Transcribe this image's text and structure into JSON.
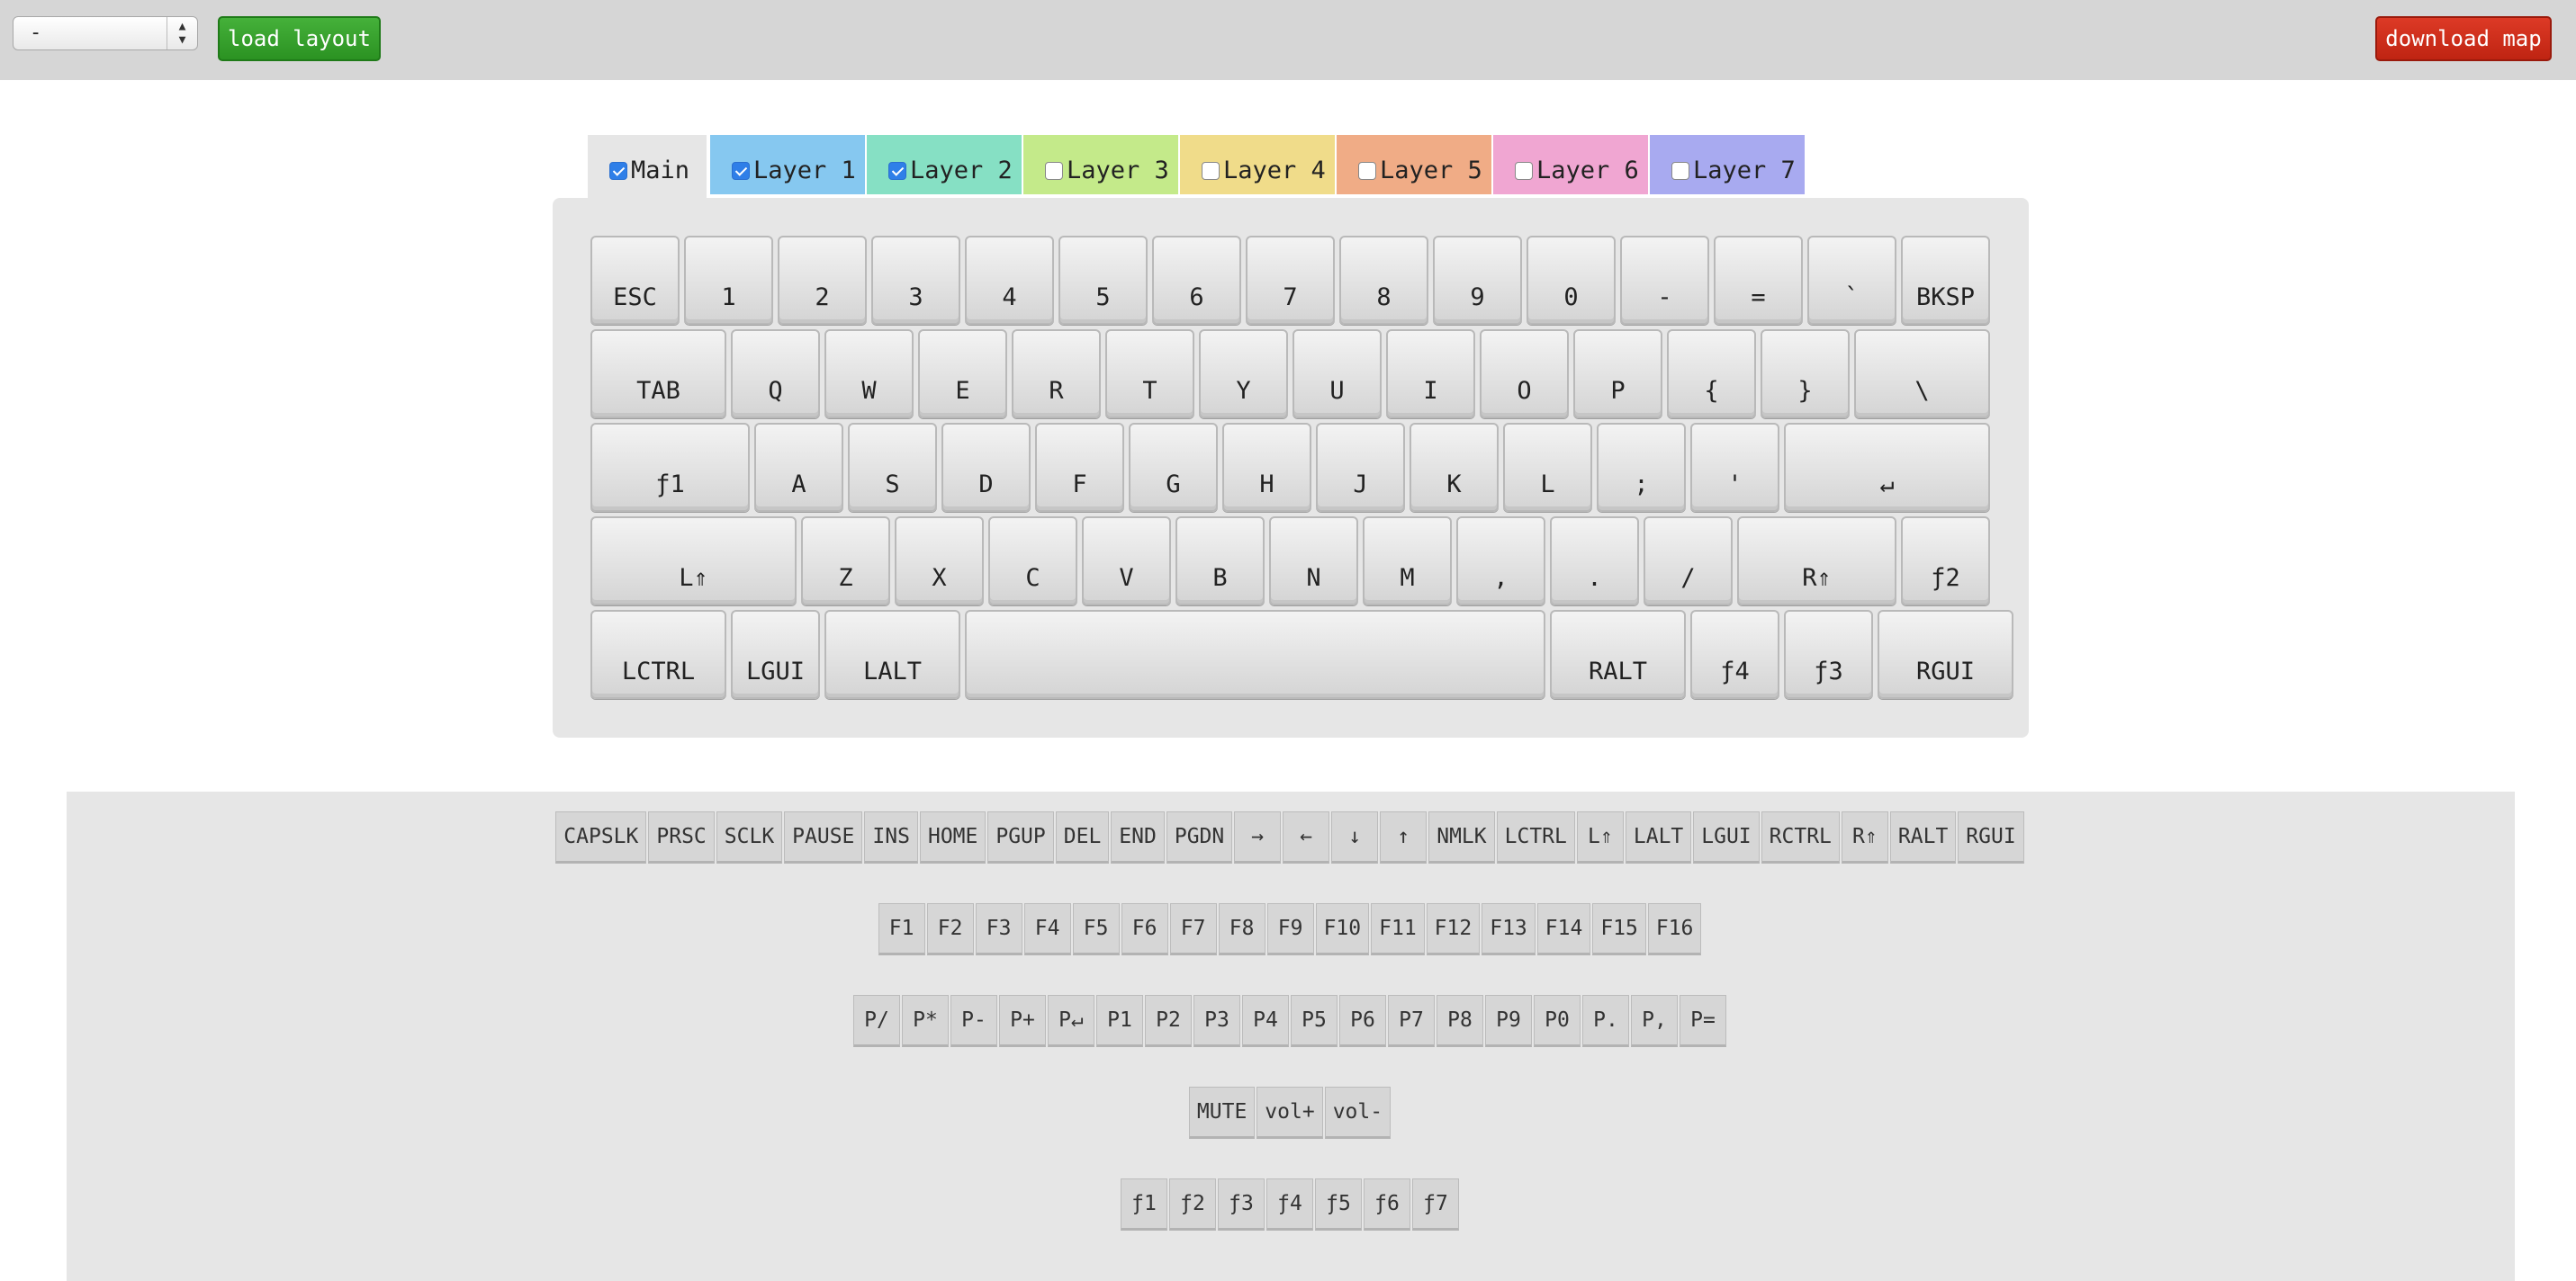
{
  "toolbar": {
    "layout_select_value": "-",
    "load_label": "load layout",
    "download_label": "download map",
    "colors": {
      "load": "#2e9a25",
      "download": "#d02f1b"
    }
  },
  "tabs": [
    {
      "label": "Main",
      "checked": true,
      "color": "#e6e6e6"
    },
    {
      "label": "Layer 1",
      "checked": true,
      "color": "#86c8f0"
    },
    {
      "label": "Layer 2",
      "checked": true,
      "color": "#86e0c4"
    },
    {
      "label": "Layer 3",
      "checked": false,
      "color": "#c4ea8a"
    },
    {
      "label": "Layer 4",
      "checked": false,
      "color": "#f0dc8a"
    },
    {
      "label": "Layer 5",
      "checked": false,
      "color": "#f0ac86"
    },
    {
      "label": "Layer 6",
      "checked": false,
      "color": "#f0a6d2"
    },
    {
      "label": "Layer 7",
      "checked": false,
      "color": "#a8aaf0"
    }
  ],
  "keyboard": {
    "rows": [
      [
        "ESC",
        "1",
        "2",
        "3",
        "4",
        "5",
        "6",
        "7",
        "8",
        "9",
        "0",
        "-",
        "=",
        "`",
        "BKSP"
      ],
      [
        "TAB",
        "Q",
        "W",
        "E",
        "R",
        "T",
        "Y",
        "U",
        "I",
        "O",
        "P",
        "{",
        "}",
        "\\"
      ],
      [
        "ƒ1",
        "A",
        "S",
        "D",
        "F",
        "G",
        "H",
        "J",
        "K",
        "L",
        ";",
        "'",
        "↵"
      ],
      [
        "L⇑",
        "Z",
        "X",
        "C",
        "V",
        "B",
        "N",
        "M",
        ",",
        ".",
        "/",
        "R⇑",
        "ƒ2"
      ],
      [
        "LCTRL",
        "LGUI",
        "LALT",
        "",
        "RALT",
        "ƒ4",
        "ƒ3",
        "RGUI"
      ]
    ]
  },
  "palette": {
    "rows": [
      [
        "CAPSLK",
        "PRSC",
        "SCLK",
        "PAUSE",
        "INS",
        "HOME",
        "PGUP",
        "DEL",
        "END",
        "PGDN",
        "→",
        "←",
        "↓",
        "↑",
        "NMLK",
        "LCTRL",
        "L⇑",
        "LALT",
        "LGUI",
        "RCTRL",
        "R⇑",
        "RALT",
        "RGUI"
      ],
      [
        "F1",
        "F2",
        "F3",
        "F4",
        "F5",
        "F6",
        "F7",
        "F8",
        "F9",
        "F10",
        "F11",
        "F12",
        "F13",
        "F14",
        "F15",
        "F16"
      ],
      [
        "P/",
        "P*",
        "P-",
        "P+",
        "P↵",
        "P1",
        "P2",
        "P3",
        "P4",
        "P5",
        "P6",
        "P7",
        "P8",
        "P9",
        "P0",
        "P.",
        "P,",
        "P="
      ],
      [
        "MUTE",
        "vol+",
        "vol-"
      ],
      [
        "ƒ1",
        "ƒ2",
        "ƒ3",
        "ƒ4",
        "ƒ5",
        "ƒ6",
        "ƒ7"
      ]
    ]
  }
}
